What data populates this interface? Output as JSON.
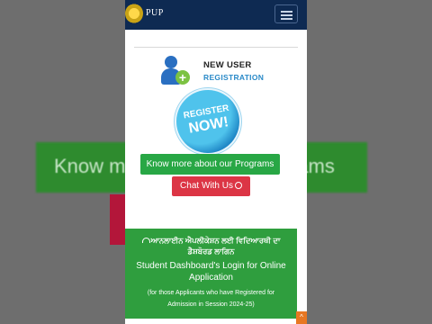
{
  "background": {
    "band_text": "Know more about our Programs"
  },
  "header": {
    "brand": "PUP",
    "menu_icon": "hamburger-icon"
  },
  "new_user": {
    "line1": "NEW USER",
    "line2": "REGISTRATION"
  },
  "register_badge": {
    "line1": "REGISTER",
    "line2": "NOW!"
  },
  "buttons": {
    "programs": "Know more about our Programs",
    "chat": "Chat With Us"
  },
  "dashboard": {
    "punjabi": "ਆਨਲਾਈਨ ਐਪਲੀਕੇਸ਼ਨ ਲਈ ਵਿਦਿਆਰਥੀ ਦਾ ਡੈਸ਼ਬੋਰਡ ਲਾਗਿਨ",
    "title": "Student Dashboard's Login for Online Application",
    "note": "(for those Applicants who have Registered for Admission in Session 2024-25)"
  },
  "scroll_top": "^",
  "colors": {
    "navbar": "#0e2a52",
    "green": "#28a745",
    "red": "#dc3545",
    "dashboard_green": "#2f9e3e"
  }
}
